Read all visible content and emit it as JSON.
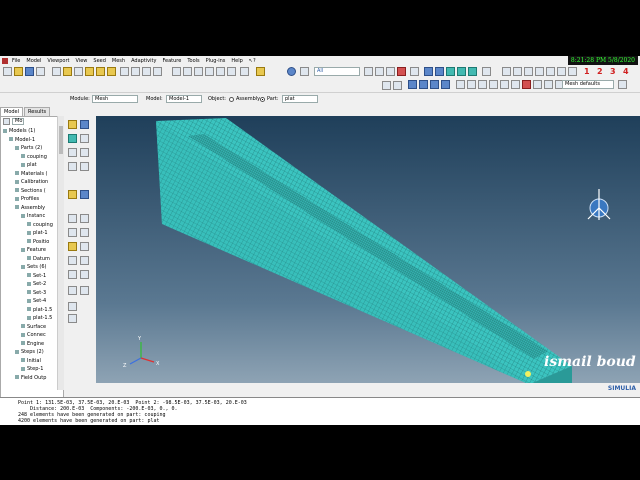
{
  "menu": [
    "File",
    "Model",
    "Viewport",
    "View",
    "Seed",
    "Mesh",
    "Adaptivity",
    "Feature",
    "Tools",
    "Plug-ins",
    "Help",
    "↖?"
  ],
  "clock": "8:21:28 PM 5/8/2020",
  "toolbar": {
    "filter_value": "All",
    "view_numbers": [
      "1",
      "2",
      "3",
      "4"
    ],
    "mesh_defaults": "Mesh defaults"
  },
  "context": {
    "module_label": "Module:",
    "module_value": "Mesh",
    "model_label": "Model:",
    "model_value": "Model-1",
    "object_label": "Object:",
    "assembly_label": "Assembly",
    "part_label": "Part:",
    "part_value": "plat"
  },
  "tabs": [
    "Model",
    "Results"
  ],
  "tree_search": "Mo",
  "tree": [
    {
      "label": "Models (1)",
      "indent": 0
    },
    {
      "label": "Model-1",
      "indent": 1
    },
    {
      "label": "Parts (2)",
      "indent": 2
    },
    {
      "label": "couping",
      "indent": 3
    },
    {
      "label": "plat",
      "indent": 3
    },
    {
      "label": "Materials (",
      "indent": 2
    },
    {
      "label": "Calibration",
      "indent": 2
    },
    {
      "label": "Sections (",
      "indent": 2
    },
    {
      "label": "Profiles",
      "indent": 2
    },
    {
      "label": "Assembly",
      "indent": 2
    },
    {
      "label": "Instanc",
      "indent": 3
    },
    {
      "label": "couping",
      "indent": 4
    },
    {
      "label": "plat-1",
      "indent": 4
    },
    {
      "label": "Positio",
      "indent": 4
    },
    {
      "label": "Feature",
      "indent": 3
    },
    {
      "label": "Datum",
      "indent": 4
    },
    {
      "label": "Sets (6)",
      "indent": 3
    },
    {
      "label": "Set-1",
      "indent": 4
    },
    {
      "label": "Set-2",
      "indent": 4
    },
    {
      "label": "Set-3",
      "indent": 4
    },
    {
      "label": "Set-4",
      "indent": 4
    },
    {
      "label": "plat-1.5",
      "indent": 4
    },
    {
      "label": "plat-1.5",
      "indent": 4
    },
    {
      "label": "Surface",
      "indent": 3
    },
    {
      "label": "Connec",
      "indent": 3
    },
    {
      "label": "Engine",
      "indent": 3
    },
    {
      "label": "Steps (2)",
      "indent": 2
    },
    {
      "label": "Initial",
      "indent": 3
    },
    {
      "label": "Step-1",
      "indent": 3
    },
    {
      "label": "Field Outp",
      "indent": 2
    }
  ],
  "axis": {
    "x": "X",
    "y": "Y",
    "z": "Z"
  },
  "watermark": "ismail boud",
  "brand": "SIMULIA",
  "messages": [
    "Point 1: 131.5E-03, 37.5E-03, 20.E-03  Point 2: -98.5E-03, 37.5E-03, 20.E-03",
    "    Distance: 200.E-03  Components: -200.E-03, 0., 0.",
    "248 elements have been generated on part: couping",
    "4200 elements have been generated on part: plat"
  ],
  "colors": {
    "mesh_face": "#3bc4c0",
    "mesh_side": "#2ea9a6",
    "viewport_top": "#1f3f5a"
  }
}
